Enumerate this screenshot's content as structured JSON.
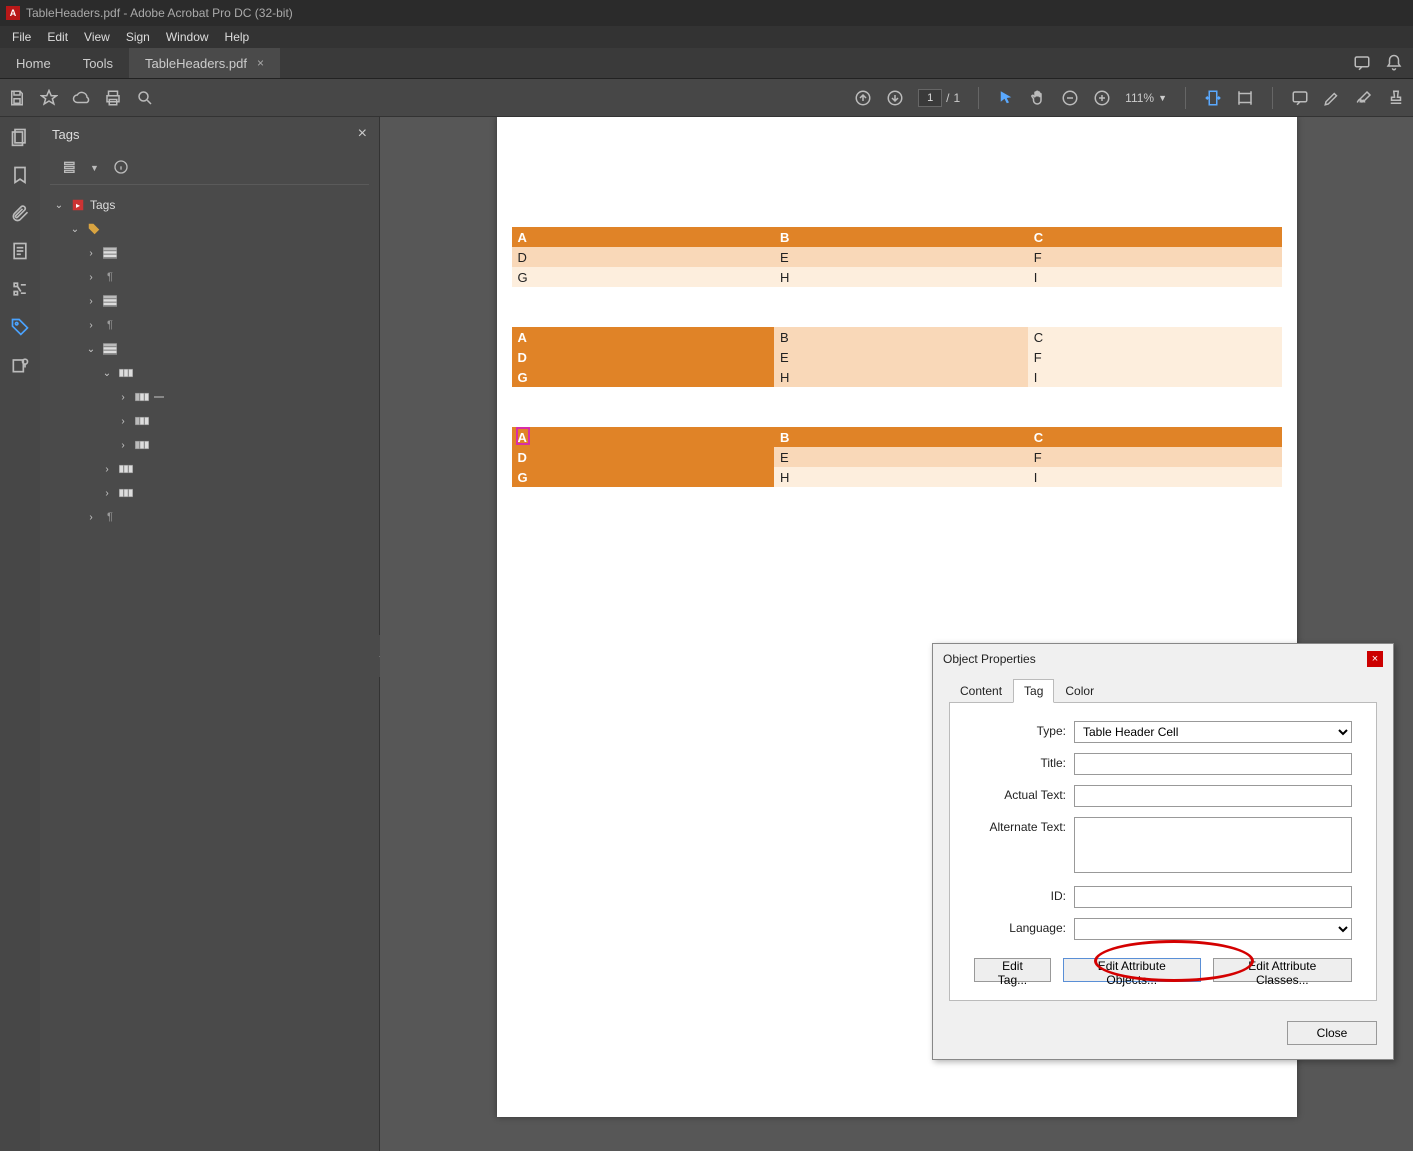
{
  "titlebar": {
    "text": "TableHeaders.pdf - Adobe Acrobat Pro DC (32-bit)"
  },
  "menu": {
    "items": [
      "File",
      "Edit",
      "View",
      "Sign",
      "Window",
      "Help"
    ]
  },
  "tabstrip": {
    "home": "Home",
    "tools": "Tools",
    "doc": "TableHeaders.pdf"
  },
  "toolbar": {
    "page_current": "1",
    "page_total": "1",
    "zoom": "111%"
  },
  "panel": {
    "title": "Tags",
    "tree": [
      {
        "depth": 0,
        "arrow": "v",
        "icon": "root",
        "label": "Tags"
      },
      {
        "depth": 1,
        "arrow": "v",
        "icon": "doc",
        "label": "<Document>"
      },
      {
        "depth": 2,
        "arrow": ">",
        "icon": "table",
        "label": "<Table>"
      },
      {
        "depth": 2,
        "arrow": ">",
        "icon": "p",
        "label": "<P>"
      },
      {
        "depth": 2,
        "arrow": ">",
        "icon": "table",
        "label": "<Table>"
      },
      {
        "depth": 2,
        "arrow": ">",
        "icon": "p",
        "label": "<P>"
      },
      {
        "depth": 2,
        "arrow": "v",
        "icon": "table",
        "label": "<Table>"
      },
      {
        "depth": 3,
        "arrow": "v",
        "icon": "tr",
        "label": "<TR>"
      },
      {
        "depth": 4,
        "arrow": ">",
        "icon": "th",
        "label": "<TH>",
        "selected": true
      },
      {
        "depth": 4,
        "arrow": ">",
        "icon": "th",
        "label": "<TH>"
      },
      {
        "depth": 4,
        "arrow": ">",
        "icon": "th",
        "label": "<TH>"
      },
      {
        "depth": 3,
        "arrow": ">",
        "icon": "tr",
        "label": "<TR>"
      },
      {
        "depth": 3,
        "arrow": ">",
        "icon": "tr",
        "label": "<TR>"
      },
      {
        "depth": 2,
        "arrow": ">",
        "icon": "p",
        "label": "<P>"
      }
    ]
  },
  "tables": {
    "t1": [
      [
        "A",
        "B",
        "C"
      ],
      [
        "D",
        "E",
        "F"
      ],
      [
        "G",
        "H",
        "I"
      ]
    ],
    "t2": [
      [
        "A",
        "B",
        "C"
      ],
      [
        "D",
        "E",
        "F"
      ],
      [
        "G",
        "H",
        "I"
      ]
    ],
    "t3": [
      [
        "A",
        "B",
        "C"
      ],
      [
        "D",
        "E",
        "F"
      ],
      [
        "G",
        "H",
        "I"
      ]
    ]
  },
  "dialog": {
    "title": "Object Properties",
    "tabs": {
      "content": "Content",
      "tag": "Tag",
      "color": "Color"
    },
    "fields": {
      "type_label": "Type:",
      "type_value": "Table Header Cell",
      "title_label": "Title:",
      "title_value": "",
      "actual_label": "Actual Text:",
      "actual_value": "",
      "alt_label": "Alternate Text:",
      "alt_value": "",
      "id_label": "ID:",
      "id_value": "",
      "lang_label": "Language:",
      "lang_value": ""
    },
    "buttons": {
      "edit_tag": "Edit Tag...",
      "edit_attr": "Edit Attribute Objects...",
      "edit_class": "Edit Attribute Classes...",
      "close": "Close"
    }
  }
}
